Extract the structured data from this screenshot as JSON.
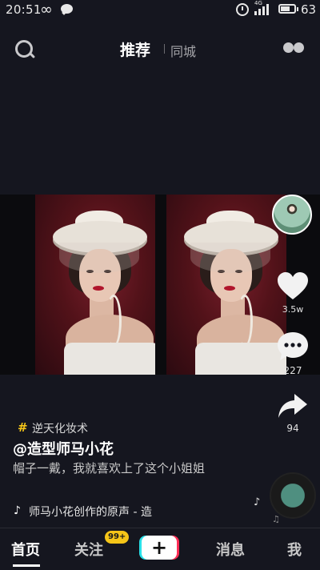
{
  "status": {
    "time": "20:51",
    "battery": "63",
    "network": "4G"
  },
  "topnav": {
    "tab_recommend": "推荐",
    "tab_local": "同城"
  },
  "video": {
    "likes": "3.5w",
    "comments": "227",
    "shares": "94"
  },
  "caption": {
    "hashtag_icon": "#",
    "hashtag": "逆天化妆术",
    "author": "@造型师马小花",
    "description": "帽子一戴，我就喜欢上了这个小姐姐",
    "music": "师马小花创作的原声 - 造"
  },
  "tabbar": {
    "home": "首页",
    "follow": "关注",
    "follow_badge": "99+",
    "plus": "+",
    "messages": "消息",
    "me": "我"
  },
  "colors": {
    "background": "#15161f",
    "badge": "#f5c518",
    "plus_left": "#28e0e8",
    "plus_right": "#ff2d55"
  },
  "icons": [
    "search-icon",
    "more-icon",
    "heart-icon",
    "comment-icon",
    "share-icon",
    "music-note-icon",
    "music-disc-icon"
  ]
}
